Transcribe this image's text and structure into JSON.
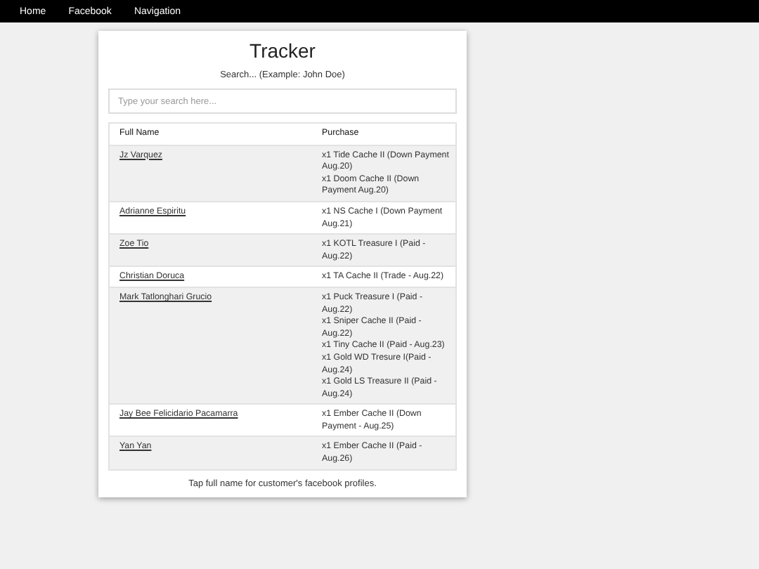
{
  "nav": [
    "Home",
    "Facebook",
    "Navigation"
  ],
  "title": "Tracker",
  "subtitle": "Search... (Example: John Doe)",
  "search": {
    "placeholder": "Type your search here..."
  },
  "table": {
    "columns": [
      "Full Name",
      "Purchase"
    ],
    "rows": [
      {
        "name": "Jz Varquez",
        "purchases": [
          "x1 Tide Cache II (Down Payment Aug.20)",
          "x1 Doom Cache II (Down Payment Aug.20)"
        ]
      },
      {
        "name": "Adrianne Espiritu",
        "purchases": [
          "x1 NS Cache I (Down Payment Aug.21)"
        ]
      },
      {
        "name": "Zoe Tio",
        "purchases": [
          "x1 KOTL Treasure I (Paid - Aug.22)"
        ]
      },
      {
        "name": "Christian Doruca",
        "purchases": [
          "x1 TA Cache II (Trade - Aug.22)"
        ]
      },
      {
        "name": "Mark Tatlonghari Grucio",
        "purchases": [
          "x1 Puck Treasure I (Paid - Aug.22)",
          "x1 Sniper Cache II (Paid - Aug.22)",
          "x1 Tiny Cache II (Paid - Aug.23)",
          "x1 Gold WD Tresure I(Paid - Aug.24)",
          "x1 Gold LS Treasure II (Paid - Aug.24)"
        ]
      },
      {
        "name": "Jay Bee Felicidario Pacamarra",
        "purchases": [
          "x1 Ember Cache II (Down Payment - Aug.25)"
        ]
      },
      {
        "name": "Yan Yan",
        "purchases": [
          "x1 Ember Cache II (Paid - Aug.26)"
        ]
      }
    ]
  },
  "footer": "Tap full name for customer's facebook profiles."
}
